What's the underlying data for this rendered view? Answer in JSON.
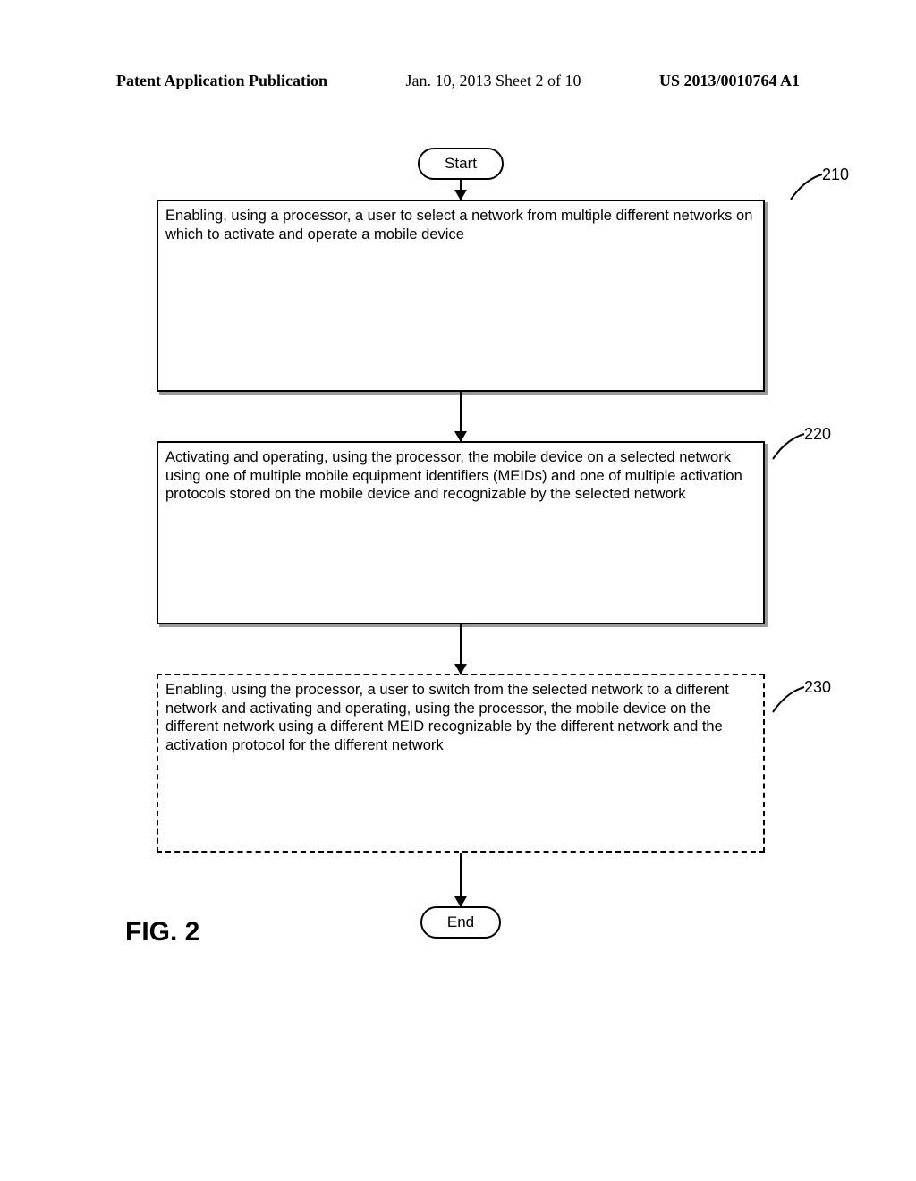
{
  "header": {
    "left": "Patent Application Publication",
    "center": "Jan. 10, 2013   Sheet 2 of 10",
    "right": "US 2013/0010764 A1"
  },
  "flow": {
    "start": "Start",
    "end": "End",
    "box210": "Enabling, using a processor, a user to select a network from multiple different networks on which to activate and operate a mobile device",
    "box220": "Activating and operating, using the processor, the mobile device on a selected network using one of multiple mobile equipment identifiers (MEIDs) and one of multiple activation protocols stored on the mobile device and recognizable by the selected network",
    "box230": "Enabling, using the processor, a user to switch from the selected network to a different network and activating and operating, using the processor, the mobile device on the different network using a different MEID recognizable by the different network and the activation protocol for the different network",
    "ref210": "210",
    "ref220": "220",
    "ref230": "230"
  },
  "figure_label": "FIG. 2"
}
